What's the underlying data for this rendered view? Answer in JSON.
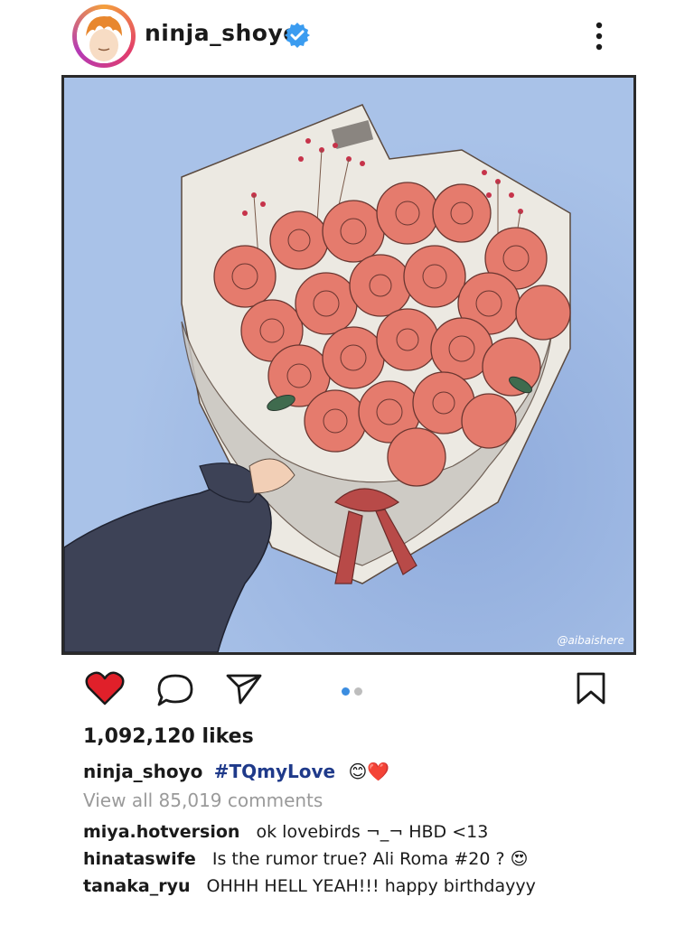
{
  "header": {
    "username": "ninja_shoyo",
    "verified_icon": "verified-badge-icon",
    "more_icon": "more-vertical-icon"
  },
  "post": {
    "watermark": "@aibaishere",
    "image_description_icon": "rose-bouquet"
  },
  "actions": {
    "like_icon": "heart-icon",
    "like_color": "#e0202a",
    "comment_icon": "comment-icon",
    "share_icon": "paper-plane-icon",
    "save_icon": "bookmark-icon",
    "carousel_active_color": "#3b8de0",
    "carousel_inactive_color": "#bdbdbd"
  },
  "stats": {
    "likes": "1,092,120 likes"
  },
  "caption": {
    "username": "ninja_shoyo",
    "hashtag": "#TQmyLove",
    "emojis": "😊❤️"
  },
  "comments_link": "View all 85,019 comments",
  "comments": [
    {
      "user": "miya.hotversion",
      "text": "ok lovebirds ¬_¬ HBD <13"
    },
    {
      "user": "hinataswife",
      "text": "Is the rumor true? Ali Roma #20 ? 😍"
    },
    {
      "user": "tanaka_ryu",
      "text": "OHHH HELL YEAH!!! happy birthdayyy"
    }
  ]
}
